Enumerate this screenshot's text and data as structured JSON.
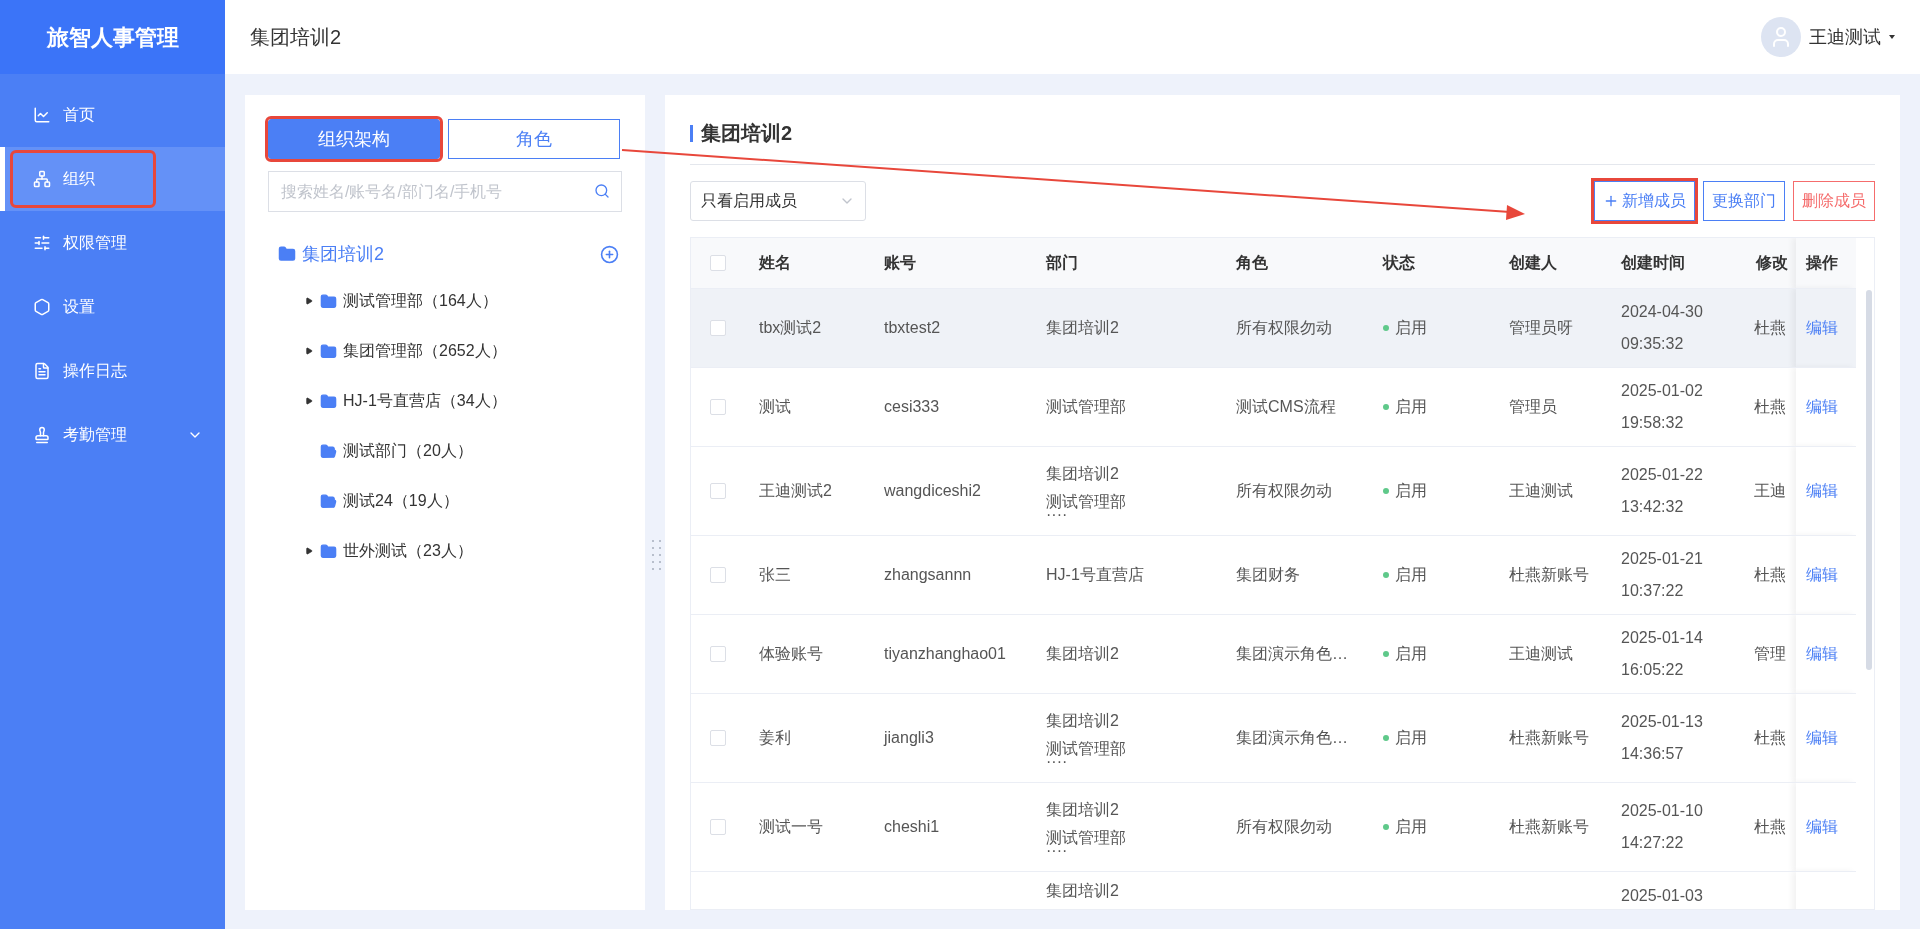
{
  "sidebar": {
    "logo": "旅智人事管理",
    "items": [
      {
        "label": "首页",
        "selected": false,
        "highlighted": false
      },
      {
        "label": "组织",
        "selected": true,
        "highlighted": true
      },
      {
        "label": "权限管理",
        "selected": false,
        "highlighted": false
      },
      {
        "label": "设置",
        "selected": false,
        "highlighted": false
      },
      {
        "label": "操作日志",
        "selected": false,
        "highlighted": false
      },
      {
        "label": "考勤管理",
        "selected": false,
        "highlighted": false,
        "expanded": false
      }
    ]
  },
  "header": {
    "title": "集团培训2",
    "user": "王迪测试"
  },
  "left_panel": {
    "tabs": [
      {
        "label": "组织架构",
        "selected": true,
        "highlighted": true
      },
      {
        "label": "角色",
        "selected": false,
        "highlighted": false
      }
    ],
    "search": {
      "placeholder": "搜索姓名/账号名/部门名/手机号"
    },
    "tree": {
      "label": "集团培训2",
      "selected": true,
      "children": [
        {
          "label": "测试管理部（164人）",
          "kind": "branch",
          "selected": false
        },
        {
          "label": "集团管理部（2652人）",
          "kind": "branch",
          "selected": false
        },
        {
          "label": "HJ-1号直营店（34人）",
          "kind": "branch",
          "selected": false
        },
        {
          "label": "测试部门（20人）",
          "kind": "leaf",
          "selected": false
        },
        {
          "label": "测试24（19人）",
          "kind": "leaf",
          "selected": false
        },
        {
          "label": "世外测试（23人）",
          "kind": "branch",
          "selected": false
        }
      ]
    }
  },
  "main": {
    "title": "集团培训2",
    "filter": "只看启用成员",
    "buttons": [
      {
        "label": "新增成员",
        "kind": "add",
        "highlighted": true
      },
      {
        "label": "更换部门",
        "kind": "primary",
        "highlighted": false
      },
      {
        "label": "删除成员",
        "kind": "danger",
        "highlighted": false
      }
    ],
    "table": {
      "select_all": {
        "checked": false
      },
      "columns": [
        "姓名",
        "账号",
        "部门",
        "角色",
        "状态",
        "创建人",
        "创建时间",
        "修改",
        "操作"
      ],
      "rows": [
        {
          "hovered": true,
          "checked": false,
          "name": "tbx测试2",
          "account": "tbxtest2",
          "departments": [
            "集团培训2"
          ],
          "role": "所有权限勿动",
          "status": {
            "label": "启用",
            "color": "#5fc98a"
          },
          "creator": "管理员呀",
          "created": [
            "2024-04-30",
            "09:35:32"
          ],
          "modified": "杜燕",
          "action": "编辑"
        },
        {
          "hovered": false,
          "checked": false,
          "name": "测试",
          "account": "cesi333",
          "departments": [
            "测试管理部"
          ],
          "role": "测试CMS流程",
          "status": {
            "label": "启用",
            "color": "#5fc98a"
          },
          "creator": "管理员",
          "created": [
            "2025-01-02",
            "19:58:32"
          ],
          "modified": "杜燕",
          "action": "编辑"
        },
        {
          "hovered": false,
          "checked": false,
          "name": "王迪测试2",
          "account": "wangdiceshi2",
          "departments": [
            "集团培训2",
            "测试管理部"
          ],
          "more": "····",
          "role": "所有权限勿动",
          "status": {
            "label": "启用",
            "color": "#5fc98a"
          },
          "creator": "王迪测试",
          "created": [
            "2025-01-22",
            "13:42:32"
          ],
          "modified": "王迪",
          "action": "编辑"
        },
        {
          "hovered": false,
          "checked": false,
          "name": "张三",
          "account": "zhangsannn",
          "departments": [
            "HJ-1号直营店"
          ],
          "role": "集团财务",
          "status": {
            "label": "启用",
            "color": "#5fc98a"
          },
          "creator": "杜燕新账号",
          "created": [
            "2025-01-21",
            "10:37:22"
          ],
          "modified": "杜燕",
          "action": "编辑"
        },
        {
          "hovered": false,
          "checked": false,
          "name": "体验账号",
          "account": "tiyanzhanghao01",
          "departments": [
            "集团培训2"
          ],
          "role": "集团演示角色…",
          "status": {
            "label": "启用",
            "color": "#5fc98a"
          },
          "creator": "王迪测试",
          "created": [
            "2025-01-14",
            "16:05:22"
          ],
          "modified": "管理",
          "action": "编辑"
        },
        {
          "hovered": false,
          "checked": false,
          "name": "姜利",
          "account": "jiangli3",
          "departments": [
            "集团培训2",
            "测试管理部"
          ],
          "more": "····",
          "role": "集团演示角色…",
          "status": {
            "label": "启用",
            "color": "#5fc98a"
          },
          "creator": "杜燕新账号",
          "created": [
            "2025-01-13",
            "14:36:57"
          ],
          "modified": "杜燕",
          "action": "编辑"
        },
        {
          "hovered": false,
          "checked": false,
          "name": "测试一号",
          "account": "cheshi1",
          "departments": [
            "集团培训2",
            "测试管理部"
          ],
          "more": "····",
          "role": "所有权限勿动",
          "status": {
            "label": "启用",
            "color": "#5fc98a"
          },
          "creator": "杜燕新账号",
          "created": [
            "2025-01-10",
            "14:27:22"
          ],
          "modified": "杜燕",
          "action": "编辑"
        },
        {
          "hovered": false,
          "departments": [
            "集团培训2"
          ],
          "created": [
            "2025-01-03"
          ]
        }
      ]
    }
  }
}
